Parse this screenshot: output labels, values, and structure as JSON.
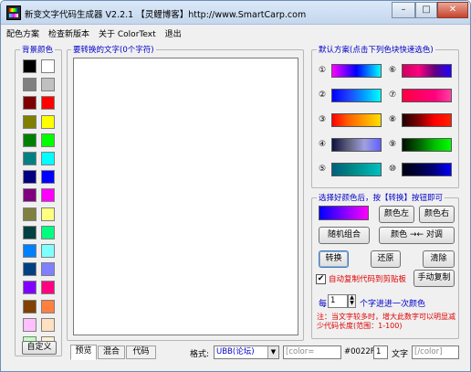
{
  "window": {
    "title": "新变文字代码生成器 V2.2.1 【灵鲤博客】http://www.SmartCarp.com",
    "minimize": "–",
    "maximize": "□",
    "close": "✕"
  },
  "menu": [
    "配色方案",
    "检查新版本",
    "关于 ColorText",
    "退出"
  ],
  "bg_colors": {
    "label": "背景颜色",
    "swatches": [
      "#000000",
      "#ffffff",
      "#808080",
      "#c0c0c0",
      "#800000",
      "#ff0000",
      "#808000",
      "#ffff00",
      "#008000",
      "#00ff00",
      "#008080",
      "#00ffff",
      "#000080",
      "#0000ff",
      "#800080",
      "#ff00ff",
      "#808040",
      "#ffff80",
      "#004040",
      "#00ff80",
      "#0080ff",
      "#80ffff",
      "#004080",
      "#8080ff",
      "#8000ff",
      "#ff0080",
      "#804000",
      "#ff8040",
      "#ffc0ff",
      "#ffe0c0",
      "#c0ffc0",
      "#fff0d0"
    ],
    "custom_button": "自定义"
  },
  "text_area": {
    "label": "要转换的文字(0个字符)",
    "value": ""
  },
  "presets": {
    "label": "默认方案(点击下列色块快速选色)",
    "items": [
      {
        "num": "①",
        "gradient": "linear-gradient(90deg,#ff00ff,#0000ff,#00ffff)"
      },
      {
        "num": "⑥",
        "gradient": "linear-gradient(90deg,#cc0060,#ff0080,#600080,#2000ff)"
      },
      {
        "num": "②",
        "gradient": "linear-gradient(90deg,#0000ff,#2040ff,#00a0ff,#00ffff)"
      },
      {
        "num": "⑦",
        "gradient": "linear-gradient(90deg,#ff0040,#ff0060,#ff0080,#ff40a0)"
      },
      {
        "num": "③",
        "gradient": "linear-gradient(90deg,#ff0000,#ff6000,#ffa000,#ffe000)"
      },
      {
        "num": "⑧",
        "gradient": "linear-gradient(90deg,#200000,#800000,#ff0000,#ff2000)"
      },
      {
        "num": "④",
        "gradient": "linear-gradient(90deg,#101040,#606080,#a0a0e0,#6060ff)"
      },
      {
        "num": "⑨",
        "gradient": "linear-gradient(90deg,#001000,#006000,#00c000,#00ff00)"
      },
      {
        "num": "⑤",
        "gradient": "linear-gradient(90deg,#006080,#008080,#00a0a0,#00c0c0)"
      },
      {
        "num": "⑩",
        "gradient": "linear-gradient(90deg,#000010,#000040,#000080,#0000ff)"
      }
    ]
  },
  "convert": {
    "label": "选择好颜色后，按【转换】按钮即可",
    "current_gradient": "linear-gradient(90deg,#0000ff,#8000ff,#ff00ff)",
    "btn_left": "颜色左",
    "btn_right": "颜色右",
    "btn_random": "随机组合",
    "btn_swap": "颜色 →← 对调",
    "btn_convert": "转换",
    "btn_restore": "还原",
    "btn_clear": "清除",
    "auto_copy_label": "自动复制代码到剪贴板",
    "auto_copy_checked": true,
    "btn_manual_copy": "手动复制",
    "per_prefix": "每",
    "per_value": "1",
    "per_suffix": "个字进进一次颜色",
    "note": "注：当文字较多时，增大此数字可以明显减少代码长度(范围：1-100)"
  },
  "bottom": {
    "tabs": [
      "预览",
      "混合",
      "代码"
    ],
    "format_label": "格式:",
    "format_value": "UBB(论坛)",
    "color_tag": "[color=",
    "color_value": "#0022FF",
    "length_value": "1",
    "text_label": "文字",
    "close_tag": "[/color]"
  }
}
